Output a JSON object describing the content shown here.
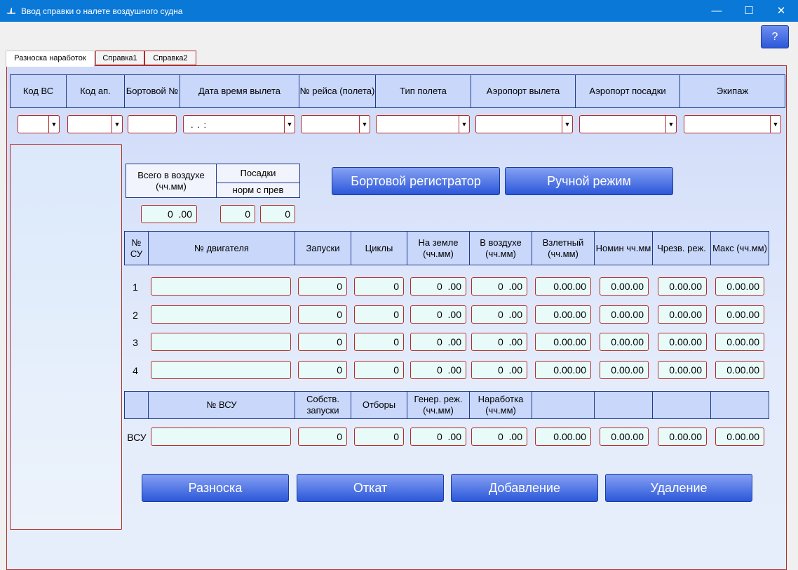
{
  "window": {
    "title": "Ввод справки о налете воздушного судна",
    "minimize": "—",
    "maximize": "☐",
    "close": "✕",
    "help": "?"
  },
  "tabs": [
    "Разноска наработок",
    "Справка1",
    "Справка2"
  ],
  "header": {
    "columns": [
      "Код ВС",
      "Код ап.",
      "Бортовой №",
      "Дата время вылета",
      "№ рейса (полета)",
      "Тип полета",
      "Аэропорт вылета",
      "Аэропорт посадки",
      "Экипаж"
    ],
    "datetime_value": ". .      :"
  },
  "summary": {
    "total_air_label": "Всего в воздухе (чч.мм)",
    "landings_label": "Посадки",
    "landings_sub": "норм  с прев",
    "total_air_value": "0  .00",
    "landings_norm": "0",
    "landings_prev": "0"
  },
  "mode_buttons": {
    "recorder": "Бортовой регистратор",
    "manual": "Ручной режим"
  },
  "engine_table": {
    "headers": [
      "№ СУ",
      "№ двигателя",
      "Запуски",
      "Циклы",
      "На земле (чч.мм)",
      "В воздухе (чч.мм)",
      "Взлетный (чч.мм)",
      "Номин чч.мм",
      "Чрезв. реж.",
      "Макс (чч.мм)"
    ],
    "rows": [
      {
        "num": "1",
        "engine": "",
        "starts": "0",
        "cycles": "0",
        "ground": "0  .00",
        "air": "0  .00",
        "takeoff": "0.00.00",
        "nominal": "0.00.00",
        "emergency": "0.00.00",
        "max": "0.00.00"
      },
      {
        "num": "2",
        "engine": "",
        "starts": "0",
        "cycles": "0",
        "ground": "0  .00",
        "air": "0  .00",
        "takeoff": "0.00.00",
        "nominal": "0.00.00",
        "emergency": "0.00.00",
        "max": "0.00.00"
      },
      {
        "num": "3",
        "engine": "",
        "starts": "0",
        "cycles": "0",
        "ground": "0  .00",
        "air": "0  .00",
        "takeoff": "0.00.00",
        "nominal": "0.00.00",
        "emergency": "0.00.00",
        "max": "0.00.00"
      },
      {
        "num": "4",
        "engine": "",
        "starts": "0",
        "cycles": "0",
        "ground": "0  .00",
        "air": "0  .00",
        "takeoff": "0.00.00",
        "nominal": "0.00.00",
        "emergency": "0.00.00",
        "max": "0.00.00"
      }
    ]
  },
  "apu_table": {
    "headers": [
      "",
      "№ ВСУ",
      "Собств. запуски",
      "Отборы",
      "Генер. реж. (чч.мм)",
      "Наработка (чч.мм)",
      "",
      "",
      "",
      ""
    ],
    "row": {
      "label": "ВСУ",
      "apu": "",
      "own_starts": "0",
      "bleeds": "0",
      "gen_mode": "0  .00",
      "operating": "0  .00",
      "c1": "0.00.00",
      "c2": "0.00.00",
      "c3": "0.00.00",
      "c4": "0.00.00"
    }
  },
  "action_buttons": [
    "Разноска",
    "Откат",
    "Добавление",
    "Удаление"
  ]
}
